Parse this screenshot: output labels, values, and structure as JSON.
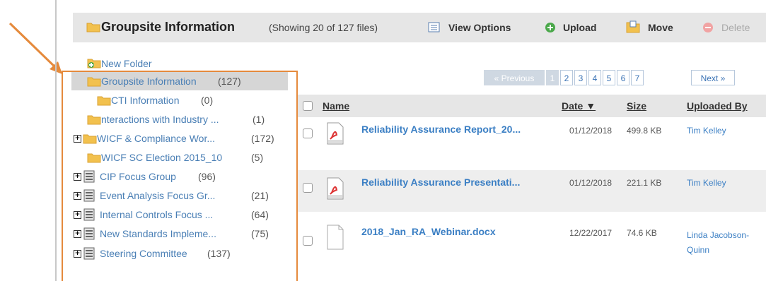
{
  "header": {
    "title": "Groupsite Information",
    "showing": "(Showing 20 of 127 files)",
    "view_options": "View Options",
    "upload": "Upload",
    "move": "Move",
    "delete": "Delete"
  },
  "tree": {
    "new_folder": "New Folder",
    "items": [
      {
        "label": "Groupsite Information",
        "count": "(127)"
      },
      {
        "label": "CTI Information",
        "count": "(0)"
      },
      {
        "label": "nteractions with Industry ...",
        "count": "(1)"
      },
      {
        "label": "WICF & Compliance Wor...",
        "count": "(172)"
      },
      {
        "label": "WICF SC Election 2015_10",
        "count": "(5)"
      },
      {
        "label": "CIP Focus Group",
        "count": "(96)"
      },
      {
        "label": "Event Analysis Focus Gr...",
        "count": "(21)"
      },
      {
        "label": "Internal Controls Focus ...",
        "count": "(64)"
      },
      {
        "label": "New Standards Impleme...",
        "count": "(75)"
      },
      {
        "label": "Steering Committee",
        "count": "(137)"
      }
    ]
  },
  "pager": {
    "previous": "« Previous",
    "pages": [
      "1",
      "2",
      "3",
      "4",
      "5",
      "6",
      "7"
    ],
    "next": "Next »"
  },
  "table": {
    "headers": {
      "name": "Name",
      "date": "Date ▼",
      "size": "Size",
      "uploaded_by": "Uploaded By"
    },
    "rows": [
      {
        "name": "Reliability Assurance Report_20...",
        "date": "01/12/2018",
        "size": "499.8 KB",
        "uploaded_by": "Tim Kelley",
        "icon": "pdf-icon"
      },
      {
        "name": "Reliability Assurance Presentati...",
        "date": "01/12/2018",
        "size": "221.1 KB",
        "uploaded_by": "Tim Kelley",
        "icon": "pdf-icon"
      },
      {
        "name": "2018_Jan_RA_Webinar.docx",
        "date": "12/22/2017",
        "size": "74.6 KB",
        "uploaded_by": "Linda Jacobson-Quinn",
        "icon": "document-icon"
      }
    ]
  },
  "colors": {
    "accent_orange": "#e58a3c",
    "link_blue": "#3b7fc4",
    "folder_yellow": "#f2c14e"
  }
}
